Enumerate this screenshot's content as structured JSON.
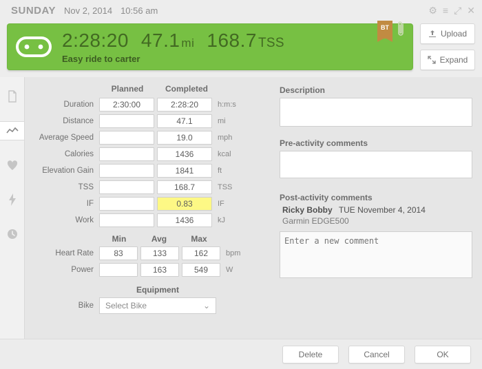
{
  "topbar": {
    "day": "SUNDAY",
    "date": "Nov 2, 2014",
    "time": "10:56 am"
  },
  "banner": {
    "duration": "2:28:20",
    "distance_val": "47.1",
    "distance_unit": "mi",
    "tss_val": "168.7",
    "tss_unit": "TSS",
    "title": "Easy ride to carter",
    "badge": "BT"
  },
  "buttons": {
    "upload": "Upload",
    "expand": "Expand",
    "delete": "Delete",
    "cancel": "Cancel",
    "ok": "OK"
  },
  "columns": {
    "planned": "Planned",
    "completed": "Completed"
  },
  "metrics": {
    "duration_label": "Duration",
    "duration_plan": "2:30:00",
    "duration_comp": "2:28:20",
    "duration_unit": "h:m:s",
    "distance_label": "Distance",
    "distance_plan": "",
    "distance_comp": "47.1",
    "distance_unit": "mi",
    "avgspeed_label": "Average Speed",
    "avgspeed_plan": "",
    "avgspeed_comp": "19.0",
    "avgspeed_unit": "mph",
    "calories_label": "Calories",
    "calories_plan": "",
    "calories_comp": "1436",
    "calories_unit": "kcal",
    "elev_label": "Elevation Gain",
    "elev_plan": "",
    "elev_comp": "1841",
    "elev_unit": "ft",
    "tss_label": "TSS",
    "tss_plan": "",
    "tss_comp": "168.7",
    "tss_unit": "TSS",
    "if_label": "IF",
    "if_plan": "",
    "if_comp": "0.83",
    "if_unit": "IF",
    "work_label": "Work",
    "work_plan": "",
    "work_comp": "1436",
    "work_unit": "kJ"
  },
  "stats_head": {
    "min": "Min",
    "avg": "Avg",
    "max": "Max"
  },
  "stats": {
    "hr_label": "Heart Rate",
    "hr_min": "83",
    "hr_avg": "133",
    "hr_max": "162",
    "hr_unit": "bpm",
    "pw_label": "Power",
    "pw_min": "",
    "pw_avg": "163",
    "pw_max": "549",
    "pw_unit": "W"
  },
  "equipment": {
    "head": "Equipment",
    "bike_label": "Bike",
    "bike_select": "Select Bike"
  },
  "right": {
    "desc_head": "Description",
    "pre_head": "Pre-activity comments",
    "post_head": "Post-activity comments",
    "post_name": "Ricky Bobby",
    "post_date": "TUE November 4, 2014",
    "post_device": "Garmin EDGE500",
    "new_comment_placeholder": "Enter a new comment"
  }
}
